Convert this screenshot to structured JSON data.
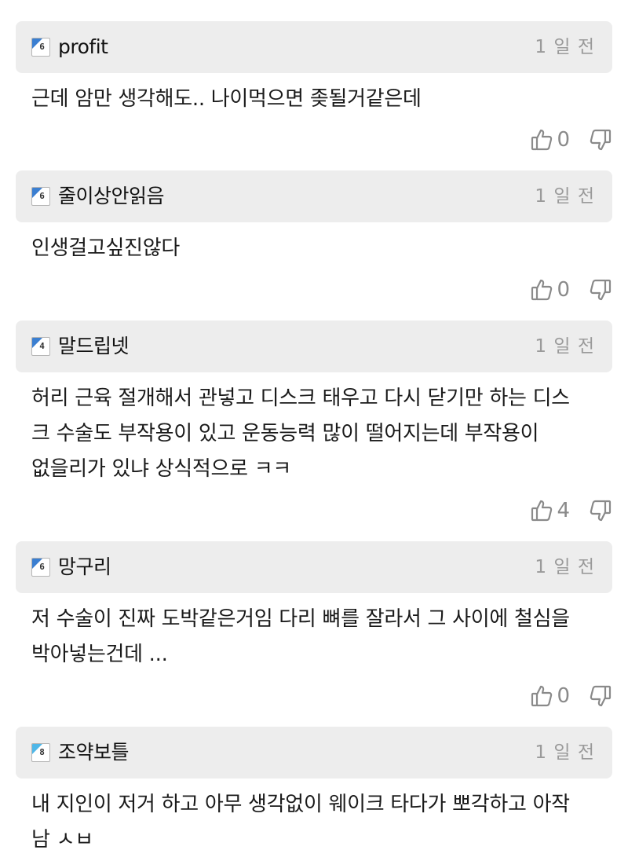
{
  "comments": [
    {
      "username": "profit",
      "level": "6",
      "time": "1 일 전",
      "text": "근데 암만 생각해도.. 나이먹으면 좆될거같은데",
      "upvotes": "0"
    },
    {
      "username": "줄이상안읽음",
      "level": "6",
      "time": "1 일 전",
      "text": "인생걸고싶진않다",
      "upvotes": "0"
    },
    {
      "username": "말드립넷",
      "level": "4",
      "time": "1 일 전",
      "text": "허리 근육 절개해서 관넣고 디스크 태우고 다시 닫기만 하는 디스\n크 수술도 부작용이 있고 운동능력 많이 떨어지는데 부작용이\n없을리가 있냐 상식적으로 ㅋㅋ",
      "upvotes": "4"
    },
    {
      "username": "망구리",
      "level": "6",
      "time": "1 일 전",
      "text": "저 수술이 진짜 도박같은거임 다리 뼈를 잘라서 그 사이에 철심을\n박아넣는건데 ...",
      "upvotes": "0"
    },
    {
      "username": "조약보틀",
      "level": "8",
      "time": "1 일 전",
      "text": "내 지인이 저거 하고 아무 생각없이 웨이크 타다가 뽀각하고 아작\n남 ㅅㅂ",
      "upvotes": null
    }
  ],
  "icons": {
    "upvote": "thumbs-up-icon",
    "downvote": "thumbs-down-icon"
  },
  "colors": {
    "header_bg": "#ededed",
    "badge_blue": "#3b7fd1",
    "badge_light_blue": "#4fb7e8",
    "timestamp": "#9a9a9a",
    "vote_gray": "#8a8a8a"
  }
}
